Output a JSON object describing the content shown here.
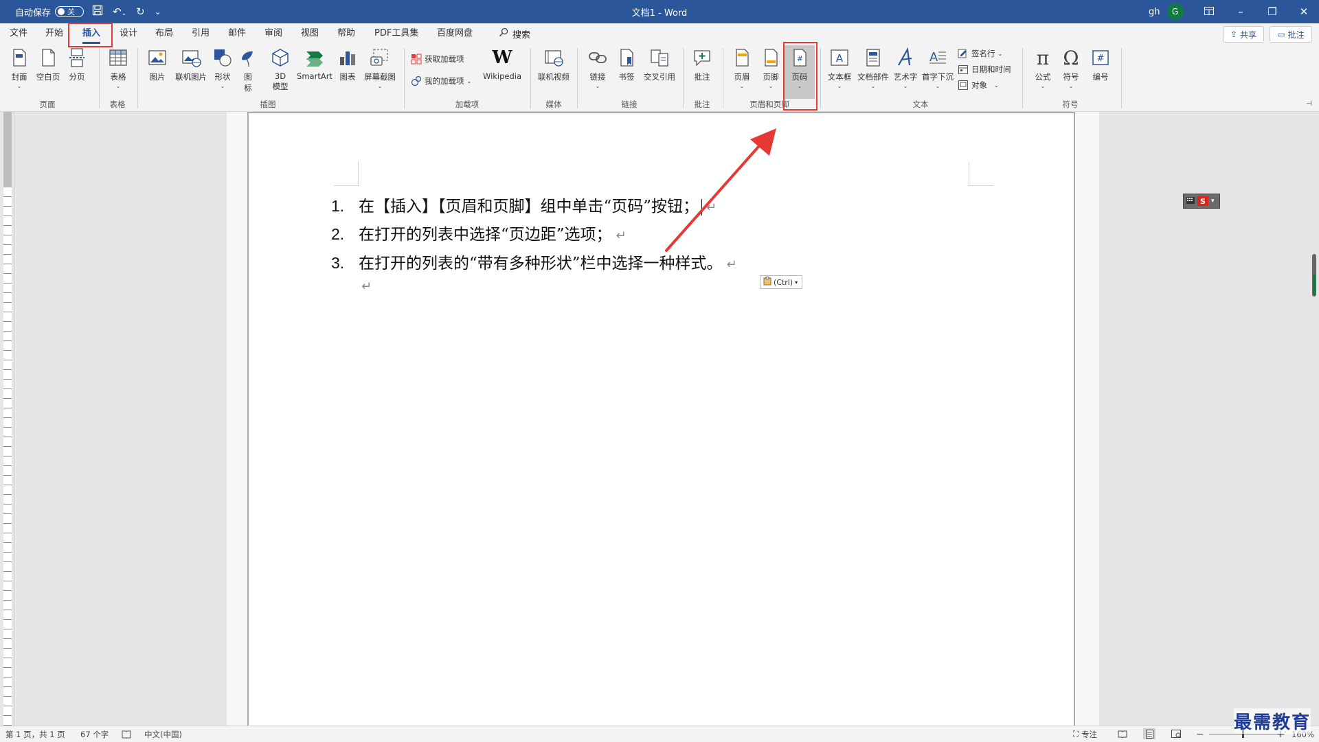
{
  "colors": {
    "brand": "#2b579a",
    "highlight": "#e53935",
    "arrow": "#e53935",
    "watermark": "#1f3c9a"
  },
  "titlebar": {
    "autosave_label": "自动保存",
    "autosave_state": "关",
    "doc_title": "文档1  -  Word",
    "user": "gh",
    "avatar_letter": "G"
  },
  "menu": {
    "tabs": [
      "文件",
      "开始",
      "插入",
      "设计",
      "布局",
      "引用",
      "邮件",
      "审阅",
      "视图",
      "帮助",
      "PDF工具集",
      "百度网盘"
    ],
    "active": "插入",
    "search": "搜索",
    "share": "共享",
    "comments": "批注"
  },
  "ribbon": {
    "page": {
      "cover": "封面",
      "blank": "空白页",
      "break": "分页",
      "group": "页面"
    },
    "table": {
      "table": "表格",
      "group": "表格"
    },
    "illustrations": {
      "picture": "图片",
      "online_picture": "联机图片",
      "shapes": "形状",
      "icons_line1": "图",
      "icons_line2": "标",
      "model_line1": "3D",
      "model_line2": "模型",
      "smartart": "SmartArt",
      "chart": "图表",
      "screenshot": "屏幕截图",
      "group": "插图"
    },
    "addins": {
      "get": "获取加载项",
      "my": "我的加载项",
      "wikipedia": "Wikipedia",
      "group": "加载项"
    },
    "media": {
      "video": "联机视频",
      "group": "媒体"
    },
    "links": {
      "link": "链接",
      "bookmark": "书签",
      "crossref": "交叉引用",
      "group": "链接"
    },
    "comments": {
      "comment": "批注",
      "group": "批注"
    },
    "headerfooter": {
      "header": "页眉",
      "footer": "页脚",
      "pagenum": "页码",
      "group": "页眉和页脚"
    },
    "text": {
      "textbox": "文本框",
      "quickparts": "文档部件",
      "wordart": "艺术字",
      "dropcap": "首字下沉",
      "signature": "签名行",
      "datetime": "日期和时间",
      "object": "对象",
      "group": "文本"
    },
    "symbols": {
      "equation": "公式",
      "symbol": "符号",
      "number": "编号",
      "group": "符号"
    }
  },
  "document": {
    "items": [
      {
        "num": "1.",
        "text": "在【插入】【页眉和页脚】组中单击“页码”按钮；"
      },
      {
        "num": "2.",
        "text": "在打开的列表中选择“页边距”选项；"
      },
      {
        "num": "3.",
        "text": "在打开的列表的“带有多种形状”栏中选择一种样式。"
      }
    ],
    "paste_options": "(Ctrl)"
  },
  "status": {
    "page": "第 1 页，共 1 页",
    "words": "67 个字",
    "language": "中文(中国)",
    "focus": "专注",
    "zoom_minus": "−",
    "zoom_plus": "+",
    "zoom": "160%"
  },
  "watermark": "最需教育"
}
